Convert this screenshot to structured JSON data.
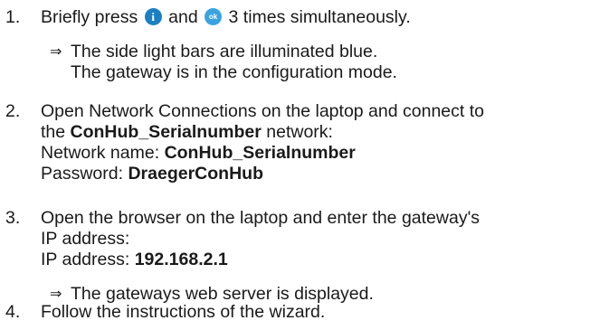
{
  "steps": [
    {
      "number": "1.",
      "text_before": "Briefly press",
      "icon_info_glyph": "i",
      "text_and": "and",
      "icon_ok_glyph": "ok",
      "text_after": "3 times simultaneously.",
      "result_arrow": "⇒",
      "result_line1": "The side light bars are illuminated blue.",
      "result_line2": "The gateway is in the configuration mode."
    },
    {
      "number": "2.",
      "line1": "Open Network Connections on the laptop and connect to",
      "line2_prefix": "the",
      "line2_bold": "ConHub_Serialnumber",
      "line2_suffix": "network:",
      "line3_label": "Network name:",
      "line3_value": "ConHub_Serialnumber",
      "line4_label": "Password:",
      "line4_value": "DraegerConHub"
    },
    {
      "number": "3.",
      "line1": "Open the browser on the laptop and enter the gateway's",
      "line2": "IP address:",
      "line3_label": "IP address:",
      "line3_value": "192.168.2.1",
      "result_arrow": "⇒",
      "result_line1": "The gateways web server is displayed."
    },
    {
      "number": "4.",
      "line1": "Follow the instructions of the wizard."
    }
  ],
  "colors": {
    "info_button": "#1c7fc1",
    "ok_button": "#3aa3e0",
    "text": "#1a1a1a"
  },
  "icons": {
    "info": "info-button-icon",
    "ok": "ok-button-icon"
  }
}
